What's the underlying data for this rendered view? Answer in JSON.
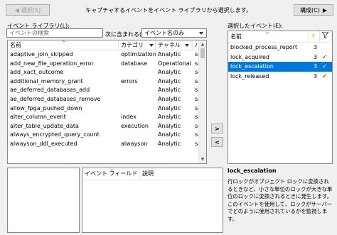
{
  "toolbar": {
    "back_label": "選択(S)",
    "instruction": "キャプチャするイベントをイベント ライブラリから選択します。",
    "config_label": "構成(C)"
  },
  "library": {
    "label": "イベント ライブラリ(L):",
    "search_placeholder": "イベントの検索",
    "contains_label": "次に含まれる(I)",
    "filter_value": "イベント名のみ",
    "columns": [
      "名前",
      "カテゴリ",
      "チャネル",
      "パ"
    ],
    "rows": [
      {
        "name": "adaptive_join_skipped",
        "category": "optimization",
        "channel": "Analytic",
        "pkg": "se"
      },
      {
        "name": "add_new_file_operation_error",
        "category": "database",
        "channel": "Operational",
        "pkg": "se"
      },
      {
        "name": "add_xact_outcome",
        "category": "",
        "channel": "Analytic",
        "pkg": "se"
      },
      {
        "name": "additional_memory_grant",
        "category": "errors",
        "channel": "Analytic",
        "pkg": "se"
      },
      {
        "name": "ae_deferred_databases_add",
        "category": "",
        "channel": "Analytic",
        "pkg": "se"
      },
      {
        "name": "ae_deferred_databases_remove",
        "category": "",
        "channel": "Analytic",
        "pkg": "se"
      },
      {
        "name": "allow_fpga_pushed_down",
        "category": "",
        "channel": "Analytic",
        "pkg": "se"
      },
      {
        "name": "alter_column_event",
        "category": "index",
        "channel": "Analytic",
        "pkg": "se"
      },
      {
        "name": "alter_table_update_data",
        "category": "execution",
        "channel": "Analytic",
        "pkg": "se"
      },
      {
        "name": "always_encrypted_query_count",
        "category": "",
        "channel": "Analytic",
        "pkg": "se"
      },
      {
        "name": "alwayson_ddl_executed",
        "category": "alwayson",
        "channel": "Analytic",
        "pkg": "se"
      }
    ]
  },
  "transfer": {
    "add": ">",
    "remove": "<"
  },
  "selected": {
    "label": "選択したイベント(E):",
    "columns": [
      "名前",
      "",
      ""
    ],
    "rows": [
      {
        "name": "blocked_process_report",
        "count": "3",
        "check": ""
      },
      {
        "name": "lock_acquired",
        "count": "3",
        "check": "✓"
      },
      {
        "name": "lock_escalation",
        "count": "3",
        "check": "✓"
      },
      {
        "name": "lock_released",
        "count": "3",
        "check": "✓"
      }
    ],
    "selected_index": 2
  },
  "fields": {
    "columns": [
      "イベント フィールド",
      "説明"
    ]
  },
  "description": {
    "title": "lock_escalation",
    "text": "行ロックがオブジェクト ロックに変換されるときなど、小さな単位のロックが大きな単位のロックに変換されるときに発生します。このイベントを使用して、ロックがサーバーでどのように使用されているかを監視します。"
  },
  "colors": {
    "selection": "#0078d7",
    "accent_icon": "#f0a000"
  }
}
